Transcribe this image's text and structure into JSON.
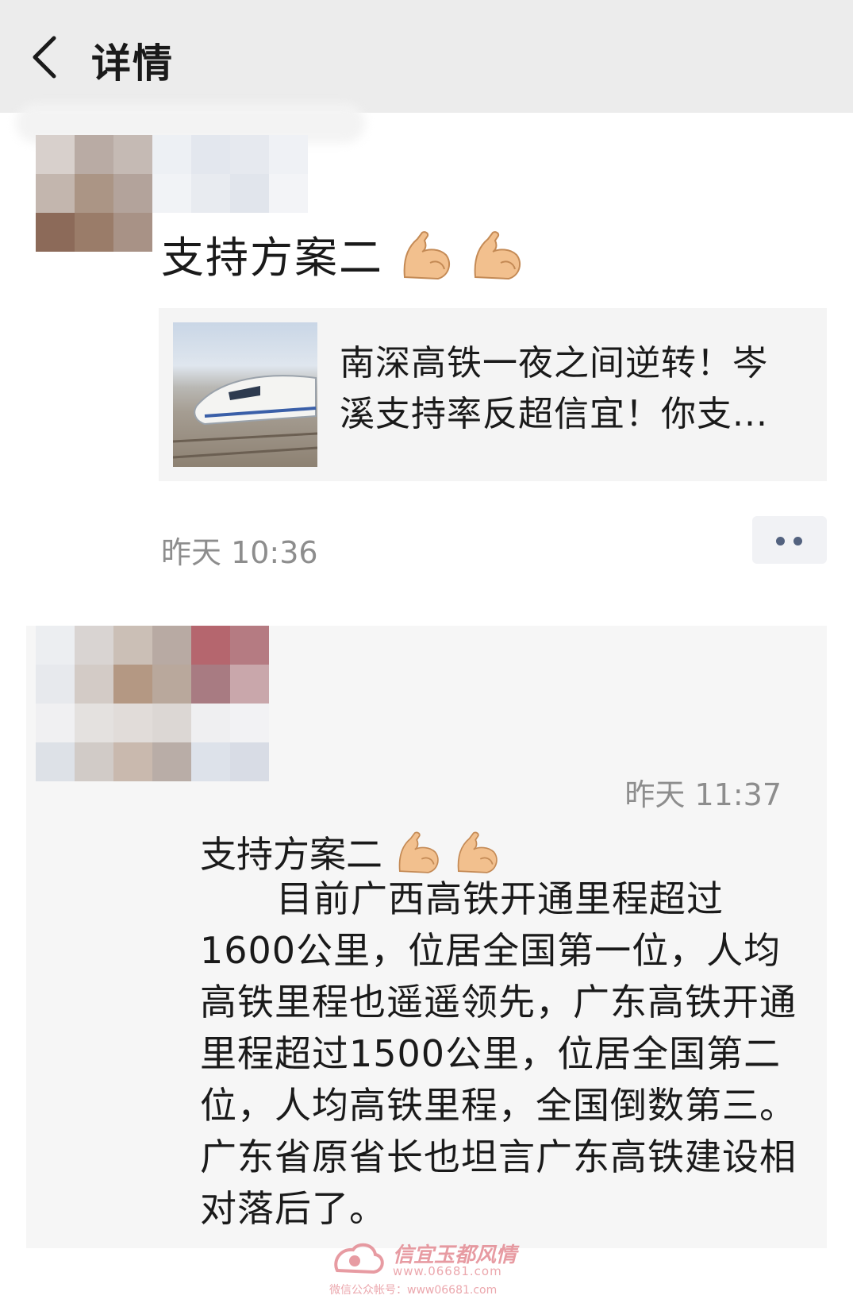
{
  "header": {
    "title": "详情"
  },
  "post": {
    "text": "支持方案二",
    "time": "昨天 10:36",
    "link_card": {
      "title": "南深高铁一夜之间逆转！岑溪支持率反超信宜！你支..."
    }
  },
  "comment": {
    "time": "昨天 11:37",
    "head": "支持方案二",
    "body": "目前广西高铁开通里程超过1600公里，位居全国第一位，人均高铁里程也遥遥领先，广东高铁开通里程超过1500公里，位居全国第二位，人均高铁里程，全国倒数第三。广东省原省长也坦言广东高铁建设相对落后了。"
  },
  "watermark": {
    "brand": "信宜玉都风情",
    "url": "www.06681.com",
    "sub": "微信公众帐号：www06681.com"
  },
  "icons": {
    "back": "chevron-left-icon",
    "emoji": "flexed-biceps-icon",
    "more": "more-dots-icon"
  }
}
